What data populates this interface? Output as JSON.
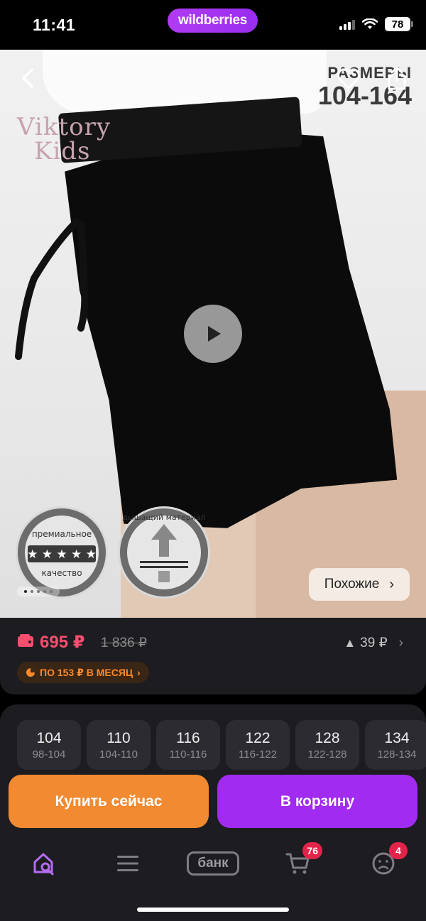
{
  "status_bar": {
    "time": "11:41",
    "brand": "wildberries",
    "battery": "78"
  },
  "photo": {
    "brand_logo": [
      "Viktory",
      "Kids"
    ],
    "promo_sizes_label": "РАЗМЕРЫ",
    "promo_sizes_range": "104-164",
    "badge_1": [
      "премиальное",
      "качество"
    ],
    "badge_2": "дышащий материал",
    "similar_button": "Похожие",
    "page_dots": {
      "count": 5,
      "active_index": 0
    }
  },
  "price": {
    "current": "695 ₽",
    "old": "1 836 ₽",
    "drop": "39 ₽",
    "installment": "ПО 153 ₽ В МЕСЯЦ"
  },
  "sizes": [
    {
      "size": "104",
      "range": "98-104"
    },
    {
      "size": "110",
      "range": "104-110"
    },
    {
      "size": "116",
      "range": "110-116"
    },
    {
      "size": "122",
      "range": "116-122"
    },
    {
      "size": "128",
      "range": "122-128"
    },
    {
      "size": "134",
      "range": "128-134"
    }
  ],
  "actions": {
    "buy_now": "Купить сейчас",
    "add_to_cart": "В корзину"
  },
  "bottom_nav": {
    "bank_label": "банк",
    "cart_badge": "76",
    "profile_badge": "4"
  },
  "colors": {
    "price_red": "#f74e6f",
    "buy_orange": "#f28a32",
    "cart_purple": "#a12bf0",
    "badge_red": "#e3244a",
    "home_active": "#b56cf3"
  },
  "icons": [
    "back-arrow-icon",
    "heart-icon",
    "share-icon",
    "play-icon",
    "wallet-icon",
    "triangle-up-icon",
    "chevron-right-icon",
    "pie-chart-icon",
    "home-search-icon",
    "menu-icon",
    "cart-icon",
    "profile-icon"
  ]
}
